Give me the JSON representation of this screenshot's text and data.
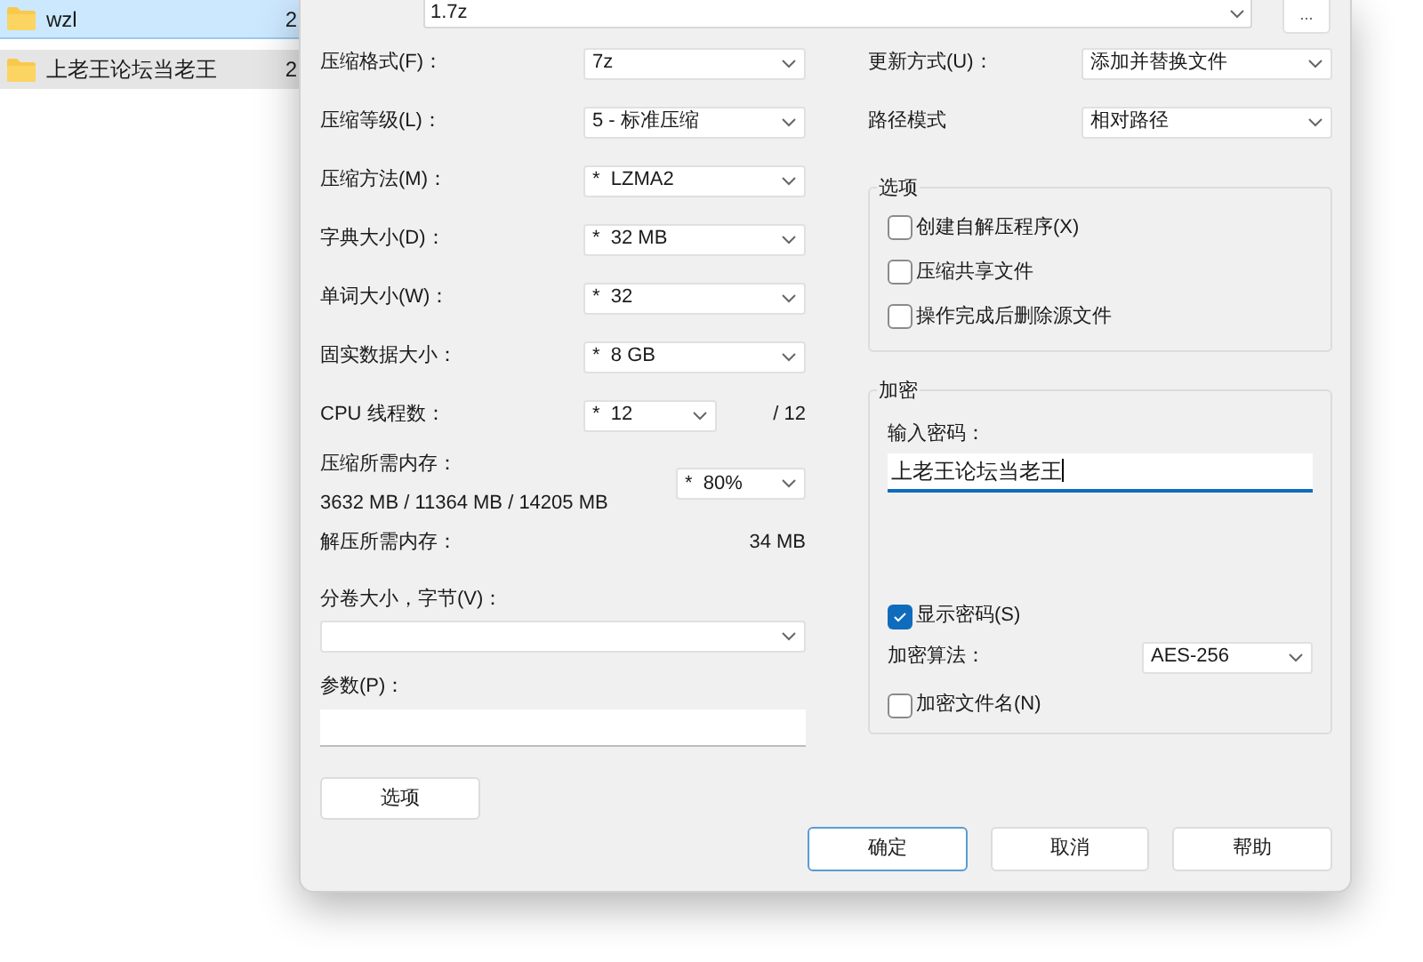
{
  "explorer": {
    "rows": [
      {
        "name": "wzl",
        "column_2": "2",
        "selected": true
      },
      {
        "name": "上老王论坛当老王",
        "column_2": "2",
        "selected": false
      }
    ]
  },
  "archive_field": {
    "value": "1.7z",
    "browse_button": "..."
  },
  "left_settings": [
    {
      "kind": "select",
      "label": "压缩格式(F)：",
      "value": "7z"
    },
    {
      "kind": "select",
      "label": "压缩等级(L)：",
      "value": "5 - 标准压缩"
    },
    {
      "kind": "select",
      "label": "压缩方法(M)：",
      "value": "*  LZMA2"
    },
    {
      "kind": "select",
      "label": "字典大小(D)：",
      "value": "*  32 MB"
    },
    {
      "kind": "select",
      "label": "单词大小(W)：",
      "value": "*  32"
    },
    {
      "kind": "select",
      "label": "固实数据大小：",
      "value": "*  8 GB"
    },
    {
      "kind": "threads",
      "label": "CPU 线程数：",
      "value": "*  12",
      "total": "/ 12"
    },
    {
      "kind": "memory",
      "label": "压缩所需内存：",
      "detail": "3632 MB / 11364 MB / 14205 MB",
      "value": "*  80%"
    },
    {
      "kind": "info",
      "label": "解压所需内存：",
      "value": "34 MB"
    }
  ],
  "volume": {
    "label": "分卷大小，字节(V)："
  },
  "parameters": {
    "label": "参数(P)："
  },
  "options_button": "选项",
  "right_settings": [
    {
      "label": "更新方式(U)：",
      "value": "添加并替换文件"
    },
    {
      "label": "路径模式",
      "value": "相对路径"
    }
  ],
  "options_group": {
    "title": "选项",
    "items": [
      {
        "label": "创建自解压程序(X)",
        "checked": false
      },
      {
        "label": "压缩共享文件",
        "checked": false
      },
      {
        "label": "操作完成后删除源文件",
        "checked": false
      }
    ]
  },
  "encryption": {
    "title": "加密",
    "password_label": "输入密码：",
    "password_value": "上老王论坛当老王",
    "show_password": {
      "label": "显示密码(S)",
      "checked": true
    },
    "method_label": "加密算法：",
    "method_value": "AES-256",
    "encrypt_names": {
      "label": "加密文件名(N)",
      "checked": false
    }
  },
  "buttons": [
    {
      "label": "确定",
      "default": true
    },
    {
      "label": "取消",
      "default": false
    },
    {
      "label": "帮助",
      "default": false
    }
  ]
}
